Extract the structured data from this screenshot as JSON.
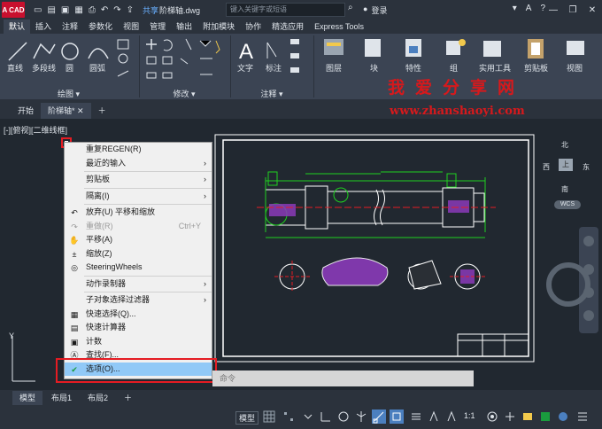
{
  "titlebar": {
    "app_logo": "A CAD",
    "share": "共享",
    "doc_title": "阶梯轴.dwg",
    "search_placeholder": "键入关键字或短语",
    "login": "登录"
  },
  "ribbon_tabs": [
    "默认",
    "插入",
    "注释",
    "参数化",
    "视图",
    "管理",
    "输出",
    "附加模块",
    "协作",
    "精选应用",
    "Express Tools"
  ],
  "ribbon": {
    "draw_tools": [
      "直线",
      "多段线",
      "圆",
      "圆弧"
    ],
    "panel_draw": "绘图",
    "panel_modify": "修改",
    "annot_tools": [
      "文字",
      "标注"
    ],
    "panel_annot": "注释",
    "big_buttons": [
      "图层",
      "块",
      "特性",
      "组",
      "实用工具",
      "剪贴板",
      "视图"
    ]
  },
  "watermark": {
    "cn": "我爱分享网",
    "url": "www.zhanshaoyi.com"
  },
  "filetabs": [
    "开始",
    "阶梯轴*"
  ],
  "viewport_label": "[-][俯视][二维线框]",
  "viewcube": {
    "north": "北",
    "south": "南",
    "east": "东",
    "west": "西",
    "top": "上",
    "wcs": "WCS"
  },
  "context_menu": [
    {
      "label": "重复REGEN(R)",
      "icon": "",
      "arrow": false
    },
    {
      "label": "最近的输入",
      "icon": "",
      "arrow": true
    },
    {
      "sep": true
    },
    {
      "label": "剪贴板",
      "icon": "",
      "arrow": true
    },
    {
      "sep": true
    },
    {
      "label": "隔离(I)",
      "icon": "",
      "arrow": true
    },
    {
      "sep": true
    },
    {
      "label": "放弃(U) 平移和缩放",
      "icon": "undo",
      "arrow": false
    },
    {
      "label": "重做(R)",
      "icon": "redo",
      "shortcut": "Ctrl+Y",
      "disabled": true
    },
    {
      "label": "平移(A)",
      "icon": "pan",
      "arrow": false
    },
    {
      "label": "缩放(Z)",
      "icon": "zoom",
      "arrow": false
    },
    {
      "label": "SteeringWheels",
      "icon": "wheel",
      "arrow": false
    },
    {
      "sep": true
    },
    {
      "label": "动作录制器",
      "icon": "",
      "arrow": true
    },
    {
      "sep": true
    },
    {
      "label": "子对象选择过滤器",
      "icon": "",
      "arrow": true
    },
    {
      "label": "快速选择(Q)...",
      "icon": "qselect",
      "arrow": false
    },
    {
      "label": "快速计算器",
      "icon": "calc",
      "arrow": false
    },
    {
      "label": "计数",
      "icon": "count",
      "arrow": false
    },
    {
      "label": "查找(F)...",
      "icon": "find",
      "arrow": false
    },
    {
      "label": "选项(O)...",
      "icon": "check",
      "arrow": false,
      "highlight": true
    }
  ],
  "cmdline_text": "命令",
  "layout_tabs": [
    "模型",
    "布局1",
    "布局2"
  ],
  "statusbar": {
    "model": "模型",
    "scale": "1:1"
  }
}
